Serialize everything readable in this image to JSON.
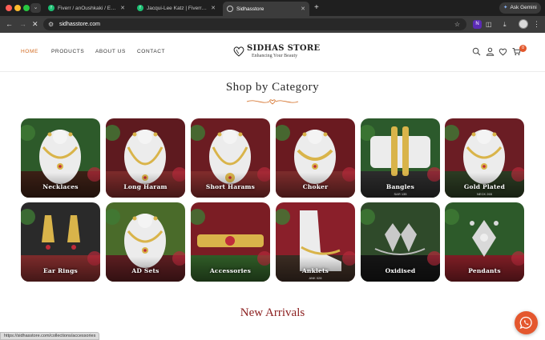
{
  "browser": {
    "tabs": [
      {
        "title": "Fiverr / anOushkaki / Edit Gig",
        "favicon": "fiverr-icon",
        "active": false
      },
      {
        "title": "Jacqui-Lee Katz | Fiverr Pro",
        "favicon": "fiverr-icon",
        "active": false
      },
      {
        "title": "Sidhasstore",
        "favicon": "globe-icon",
        "active": true
      }
    ],
    "new_tab": "+",
    "gemini_label": "Ask Gemini",
    "url": "sidhasstore.com",
    "extension_badge": "N"
  },
  "header": {
    "menu": [
      "HOME",
      "PRODUCTS",
      "ABOUT US",
      "CONTACT"
    ],
    "active_menu": "HOME",
    "logo_title": "SIDHAS STORE",
    "logo_tagline": "Enhancing Your Beauty",
    "cart_count": "0"
  },
  "shop_section": {
    "title": "Shop by Category",
    "categories": [
      {
        "label": "Necklaces",
        "price_tag": ""
      },
      {
        "label": "Long Haram",
        "price_tag": ""
      },
      {
        "label": "Short Harams",
        "price_tag": ""
      },
      {
        "label": "Choker",
        "price_tag": ""
      },
      {
        "label": "Bangles",
        "price_tag": "SAR 135"
      },
      {
        "label": "Gold Plated",
        "price_tag": "NECK 265"
      },
      {
        "label": "Ear Rings",
        "price_tag": ""
      },
      {
        "label": "AD Sets",
        "price_tag": ""
      },
      {
        "label": "Accessories",
        "price_tag": ""
      },
      {
        "label": "Anklets",
        "price_tag": "ANK 028"
      },
      {
        "label": "Oxidised",
        "price_tag": ""
      },
      {
        "label": "Pendants",
        "price_tag": ""
      }
    ]
  },
  "new_arrivals": {
    "title": "New Arrivals"
  },
  "status_bar": {
    "url": "https://sidhasstore.com/collections/accessories"
  },
  "colors": {
    "accent": "#d2691e",
    "new_arrivals_title": "#8b1e1e",
    "whatsapp_button": "#e4572e",
    "browser_chrome": "#1f1f1f"
  }
}
